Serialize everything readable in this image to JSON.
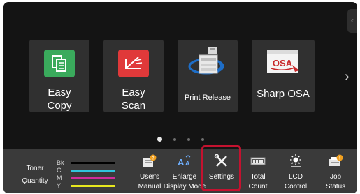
{
  "tiles": [
    {
      "label_line1": "Easy",
      "label_line2": "Copy",
      "icon": "easy-copy-icon",
      "color": "#3aaa5c"
    },
    {
      "label_line1": "Easy",
      "label_line2": "Scan",
      "icon": "easy-scan-icon",
      "color": "#e0393a"
    },
    {
      "label": "Print Release",
      "icon": "print-release-icon"
    },
    {
      "label": "Sharp OSA",
      "icon": "sharp-osa-icon"
    }
  ],
  "pager": {
    "pages": 4,
    "active": 1
  },
  "toner": {
    "label_line1": "Toner",
    "label_line2": "Quantity",
    "channels": [
      {
        "name": "Bk",
        "level": 1.0,
        "color": "#000000"
      },
      {
        "name": "C",
        "level": 1.0,
        "color": "#2fc4dc"
      },
      {
        "name": "M",
        "level": 1.0,
        "color": "#d02c9a"
      },
      {
        "name": "Y",
        "level": 1.0,
        "color": "#e6e61e"
      }
    ]
  },
  "taskbar": {
    "users_manual": {
      "line1": "User's",
      "line2": "Manual"
    },
    "enlarge_display": {
      "line1": "Enlarge",
      "line2": "Display Mode"
    },
    "settings": {
      "line1": "Settings"
    },
    "total_count": {
      "line1": "Total",
      "line2": "Count"
    },
    "lcd_control": {
      "line1": "LCD",
      "line2": "Control"
    },
    "job_status": {
      "line1": "Job",
      "line2": "Status"
    }
  },
  "highlight_color": "#c4122f"
}
